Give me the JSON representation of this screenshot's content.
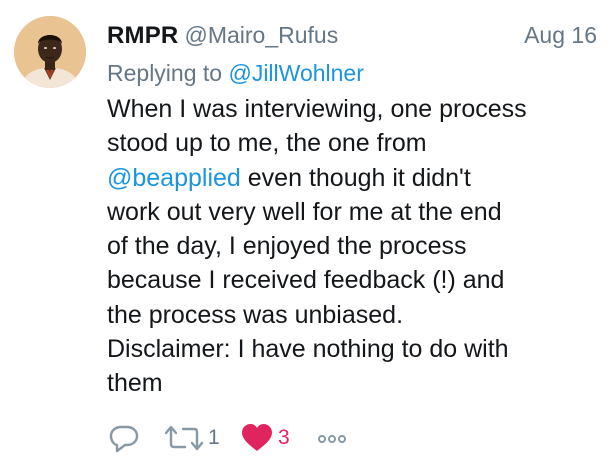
{
  "tweet": {
    "author_name": "RMPR",
    "author_handle": "@Mairo_Rufus",
    "date": "Aug 16",
    "replying_prefix": "Replying to ",
    "replying_to": "@JillWohlner",
    "lines": [
      "When I was interviewing, one process",
      "stood up to me, the one from",
      "even though it didn't",
      "work out very well for me at the end",
      "of the day, I enjoyed the process",
      "because I received feedback (!) and",
      "the process was unbiased.",
      "Disclaimer: I have nothing to do with",
      "them"
    ],
    "mention": "@beapplied",
    "retweet_count": "1",
    "like_count": "3"
  },
  "icons": {
    "reply": "reply-icon",
    "retweet": "retweet-icon",
    "like": "heart-icon",
    "more": "more-options-icon"
  },
  "colors": {
    "link": "#1b95e0",
    "secondary_text": "#657786",
    "like": "#e0245e",
    "text": "#14171a"
  }
}
